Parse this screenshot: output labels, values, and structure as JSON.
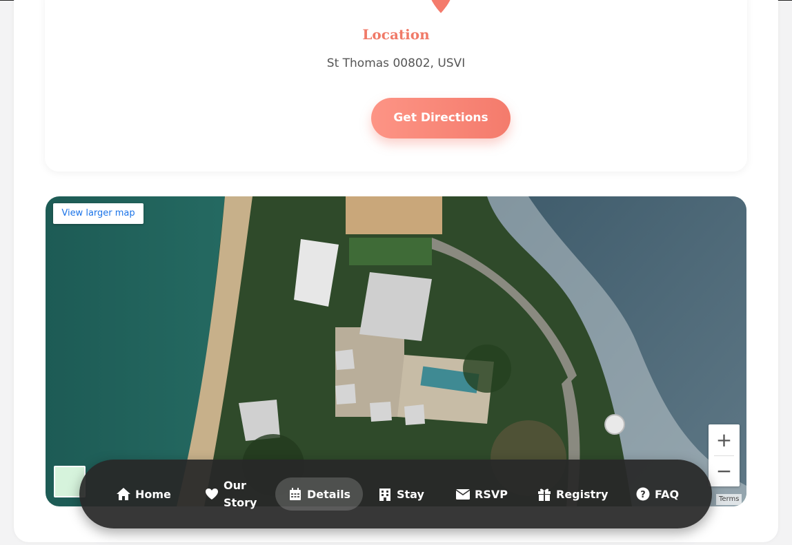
{
  "location_card": {
    "title": "Location",
    "address": "St Thomas 00802, USVI",
    "button_label": "Get Directions",
    "accent_color": "#f47b6c"
  },
  "map": {
    "larger_map_label": "View larger map",
    "zoom_in": "+",
    "zoom_out": "−",
    "terms_label": "Terms"
  },
  "nav": {
    "items": [
      {
        "label": "Home",
        "icon": "home-icon"
      },
      {
        "label": "Our",
        "label2": "Story",
        "icon": "heart-icon"
      },
      {
        "label": "Details",
        "icon": "calendar-icon",
        "active": true
      },
      {
        "label": "Stay",
        "icon": "hotel-icon"
      },
      {
        "label": "RSVP",
        "icon": "envelope-icon"
      },
      {
        "label": "Registry",
        "icon": "gift-icon"
      },
      {
        "label": "FAQ",
        "icon": "question-icon"
      }
    ]
  }
}
